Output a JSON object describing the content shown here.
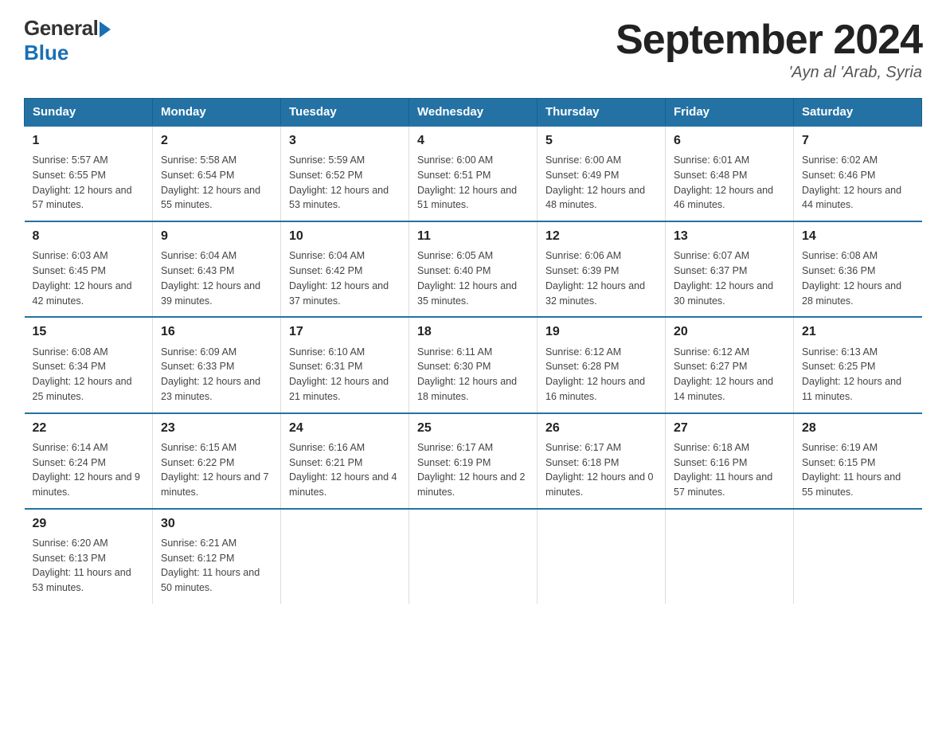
{
  "logo": {
    "general": "General",
    "blue": "Blue"
  },
  "title": "September 2024",
  "subtitle": "'Ayn al 'Arab, Syria",
  "weekdays": [
    "Sunday",
    "Monday",
    "Tuesday",
    "Wednesday",
    "Thursday",
    "Friday",
    "Saturday"
  ],
  "weeks": [
    [
      {
        "day": "1",
        "sunrise": "5:57 AM",
        "sunset": "6:55 PM",
        "daylight": "12 hours and 57 minutes."
      },
      {
        "day": "2",
        "sunrise": "5:58 AM",
        "sunset": "6:54 PM",
        "daylight": "12 hours and 55 minutes."
      },
      {
        "day": "3",
        "sunrise": "5:59 AM",
        "sunset": "6:52 PM",
        "daylight": "12 hours and 53 minutes."
      },
      {
        "day": "4",
        "sunrise": "6:00 AM",
        "sunset": "6:51 PM",
        "daylight": "12 hours and 51 minutes."
      },
      {
        "day": "5",
        "sunrise": "6:00 AM",
        "sunset": "6:49 PM",
        "daylight": "12 hours and 48 minutes."
      },
      {
        "day": "6",
        "sunrise": "6:01 AM",
        "sunset": "6:48 PM",
        "daylight": "12 hours and 46 minutes."
      },
      {
        "day": "7",
        "sunrise": "6:02 AM",
        "sunset": "6:46 PM",
        "daylight": "12 hours and 44 minutes."
      }
    ],
    [
      {
        "day": "8",
        "sunrise": "6:03 AM",
        "sunset": "6:45 PM",
        "daylight": "12 hours and 42 minutes."
      },
      {
        "day": "9",
        "sunrise": "6:04 AM",
        "sunset": "6:43 PM",
        "daylight": "12 hours and 39 minutes."
      },
      {
        "day": "10",
        "sunrise": "6:04 AM",
        "sunset": "6:42 PM",
        "daylight": "12 hours and 37 minutes."
      },
      {
        "day": "11",
        "sunrise": "6:05 AM",
        "sunset": "6:40 PM",
        "daylight": "12 hours and 35 minutes."
      },
      {
        "day": "12",
        "sunrise": "6:06 AM",
        "sunset": "6:39 PM",
        "daylight": "12 hours and 32 minutes."
      },
      {
        "day": "13",
        "sunrise": "6:07 AM",
        "sunset": "6:37 PM",
        "daylight": "12 hours and 30 minutes."
      },
      {
        "day": "14",
        "sunrise": "6:08 AM",
        "sunset": "6:36 PM",
        "daylight": "12 hours and 28 minutes."
      }
    ],
    [
      {
        "day": "15",
        "sunrise": "6:08 AM",
        "sunset": "6:34 PM",
        "daylight": "12 hours and 25 minutes."
      },
      {
        "day": "16",
        "sunrise": "6:09 AM",
        "sunset": "6:33 PM",
        "daylight": "12 hours and 23 minutes."
      },
      {
        "day": "17",
        "sunrise": "6:10 AM",
        "sunset": "6:31 PM",
        "daylight": "12 hours and 21 minutes."
      },
      {
        "day": "18",
        "sunrise": "6:11 AM",
        "sunset": "6:30 PM",
        "daylight": "12 hours and 18 minutes."
      },
      {
        "day": "19",
        "sunrise": "6:12 AM",
        "sunset": "6:28 PM",
        "daylight": "12 hours and 16 minutes."
      },
      {
        "day": "20",
        "sunrise": "6:12 AM",
        "sunset": "6:27 PM",
        "daylight": "12 hours and 14 minutes."
      },
      {
        "day": "21",
        "sunrise": "6:13 AM",
        "sunset": "6:25 PM",
        "daylight": "12 hours and 11 minutes."
      }
    ],
    [
      {
        "day": "22",
        "sunrise": "6:14 AM",
        "sunset": "6:24 PM",
        "daylight": "12 hours and 9 minutes."
      },
      {
        "day": "23",
        "sunrise": "6:15 AM",
        "sunset": "6:22 PM",
        "daylight": "12 hours and 7 minutes."
      },
      {
        "day": "24",
        "sunrise": "6:16 AM",
        "sunset": "6:21 PM",
        "daylight": "12 hours and 4 minutes."
      },
      {
        "day": "25",
        "sunrise": "6:17 AM",
        "sunset": "6:19 PM",
        "daylight": "12 hours and 2 minutes."
      },
      {
        "day": "26",
        "sunrise": "6:17 AM",
        "sunset": "6:18 PM",
        "daylight": "12 hours and 0 minutes."
      },
      {
        "day": "27",
        "sunrise": "6:18 AM",
        "sunset": "6:16 PM",
        "daylight": "11 hours and 57 minutes."
      },
      {
        "day": "28",
        "sunrise": "6:19 AM",
        "sunset": "6:15 PM",
        "daylight": "11 hours and 55 minutes."
      }
    ],
    [
      {
        "day": "29",
        "sunrise": "6:20 AM",
        "sunset": "6:13 PM",
        "daylight": "11 hours and 53 minutes."
      },
      {
        "day": "30",
        "sunrise": "6:21 AM",
        "sunset": "6:12 PM",
        "daylight": "11 hours and 50 minutes."
      },
      null,
      null,
      null,
      null,
      null
    ]
  ]
}
